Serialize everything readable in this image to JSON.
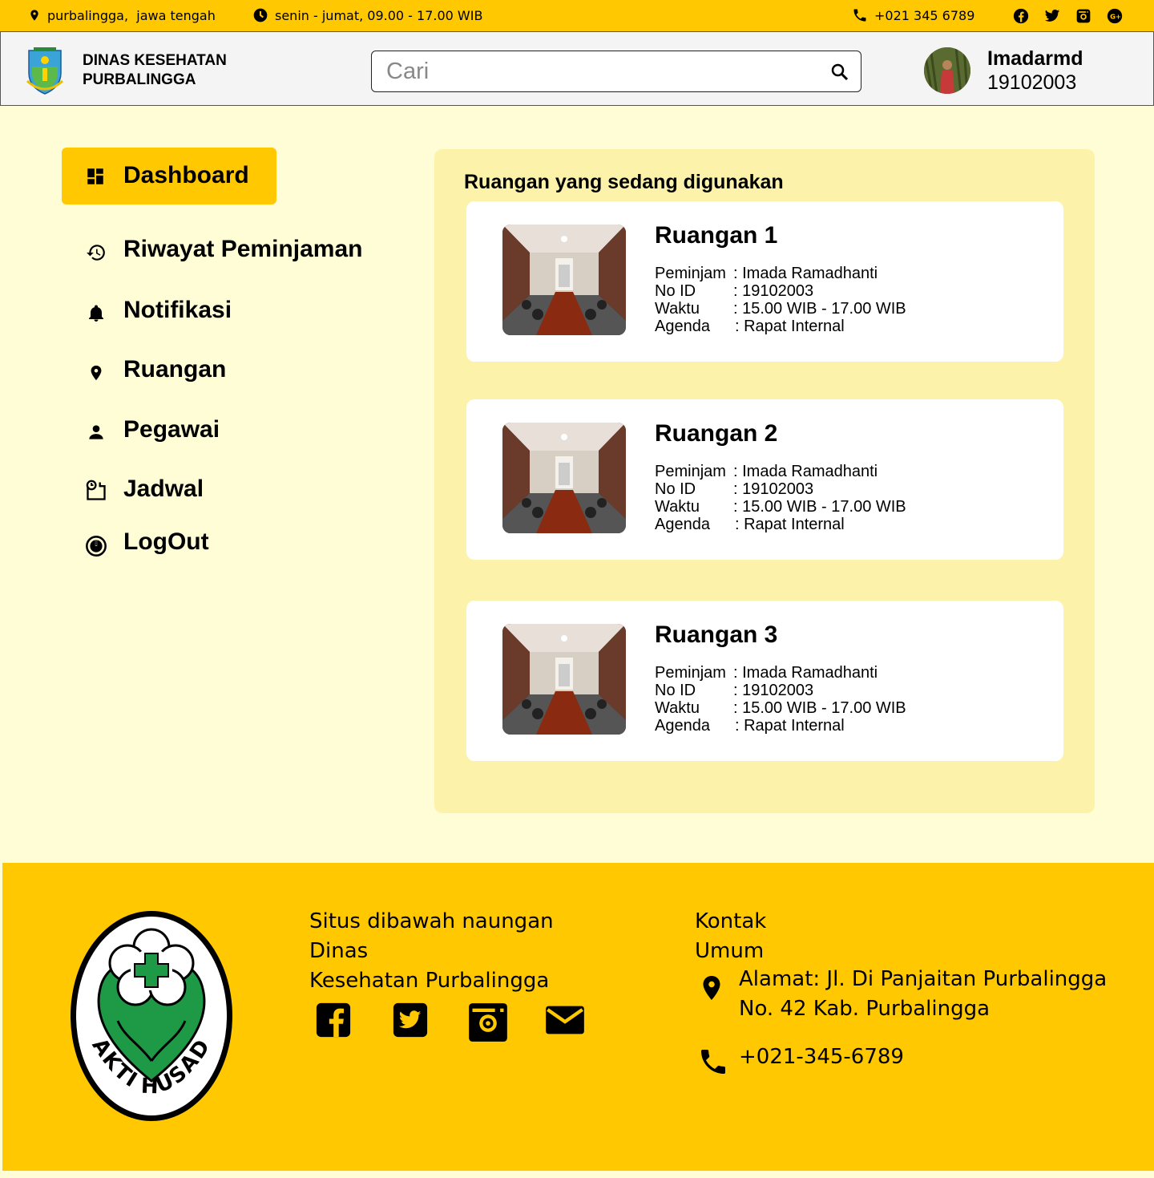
{
  "topbar": {
    "location": "purbalingga,  jawa tengah",
    "hours": "senin - jumat, 09.00 - 17.00 WIB",
    "phone": "+021 345 6789",
    "social": [
      "facebook-icon",
      "twitter-icon",
      "instagram-icon",
      "google-plus-icon"
    ]
  },
  "header": {
    "org_line1": "DINAS KESEHATAN",
    "org_line2": "PURBALINGGA",
    "search_placeholder": "Cari",
    "user_name": "Imadarmd",
    "user_id": "19102003"
  },
  "nav": {
    "items": [
      {
        "label": "Dashboard",
        "icon": "dashboard-icon",
        "active": true
      },
      {
        "label": "Riwayat Peminjaman",
        "icon": "history-icon"
      },
      {
        "label": "Notifikasi",
        "icon": "bell-icon"
      },
      {
        "label": "Ruangan",
        "icon": "location-pin-icon"
      },
      {
        "label": "Pegawai",
        "icon": "person-icon"
      },
      {
        "label": "Jadwal",
        "icon": "schedule-icon"
      },
      {
        "label": "LogOut",
        "icon": "power-icon"
      }
    ]
  },
  "main": {
    "title": "Ruangan yang sedang digunakan",
    "rooms": [
      {
        "name": "Ruangan 1",
        "peminjam_label": "Peminjam",
        "peminjam": ": Imada Ramadhanti",
        "id_label": "No ID",
        "id": ": 19102003",
        "waktu_label": "Waktu",
        "waktu": ": 15.00 WIB - 17.00 WIB",
        "agenda_label": "Agenda",
        "agenda": ": Rapat Internal"
      },
      {
        "name": "Ruangan 2",
        "peminjam_label": "Peminjam",
        "peminjam": ": Imada Ramadhanti",
        "id_label": "No ID",
        "id": ": 19102003",
        "waktu_label": "Waktu",
        "waktu": ": 15.00 WIB - 17.00 WIB",
        "agenda_label": "Agenda",
        "agenda": ": Rapat Internal"
      },
      {
        "name": "Ruangan 3",
        "peminjam_label": "Peminjam",
        "peminjam": ": Imada Ramadhanti",
        "id_label": "No ID",
        "id": ": 19102003",
        "waktu_label": "Waktu",
        "waktu": ": 15.00 WIB - 17.00 WIB",
        "agenda_label": "Agenda",
        "agenda": ": Rapat Internal"
      }
    ]
  },
  "footer": {
    "logo_text": "BAKTI HUSADA",
    "desc_line1": "Situs dibawah naungan Dinas",
    "desc_line2": "Kesehatan Purbalingga",
    "kontak_line1": "Kontak",
    "kontak_line2": "Umum",
    "address_line1": "Alamat: Jl. Di Panjaitan Purbalingga",
    "address_line2": "No. 42 Kab. Purbalingga",
    "phone": "+021-345-6789",
    "social": [
      "facebook-icon",
      "twitter-icon",
      "instagram-icon",
      "email-icon"
    ]
  },
  "colors": {
    "primary": "#ffc800",
    "background": "#fffdd6",
    "panel": "#fcf2a9",
    "green": "#1e9a47"
  }
}
